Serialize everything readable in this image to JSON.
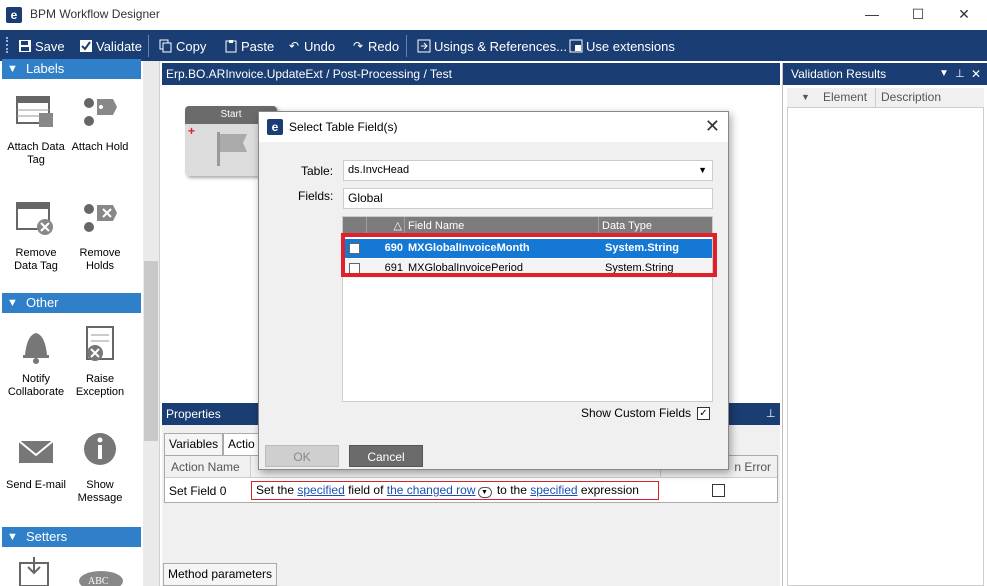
{
  "window": {
    "title": "BPM Workflow Designer",
    "minimize": "—",
    "maximize": "☐",
    "close": "✕"
  },
  "toolbar": {
    "save": "Save",
    "validate": "Validate",
    "copy": "Copy",
    "paste": "Paste",
    "undo": "Undo",
    "redo": "Redo",
    "usings": "Usings & References...",
    "extensions": "Use extensions"
  },
  "palette": {
    "labels_header": "Labels",
    "other_header": "Other",
    "setters_header": "Setters",
    "items": {
      "attach_data_tag": "Attach Data Tag",
      "attach_hold": "Attach Hold",
      "remove_data_tag": "Remove Data Tag",
      "remove_holds": "Remove Holds",
      "notify_collaborate": "Notify Collaborate",
      "raise_exception": "Raise Exception",
      "send_email": "Send E-mail",
      "show_message": "Show Message"
    }
  },
  "canvas": {
    "breadcrumb": "Erp.BO.ARInvoice.UpdateExt / Post-Processing / Test",
    "start_label": "Start"
  },
  "validation": {
    "title": "Validation Results",
    "col_element": "Element",
    "col_description": "Description"
  },
  "properties": {
    "title": "Properties",
    "tab_variables": "Variables",
    "tab_actions": "Actio",
    "col_action_name": "Action Name",
    "col_on_error": "n Error",
    "row_action": "Set Field 0",
    "expr": {
      "p1": "Set the ",
      "link1": "specified",
      "p2": " field of ",
      "link2": "the changed row",
      "p3": " to the ",
      "link3": "specified",
      "p4": " expression"
    },
    "bottom_tab": "Method parameters"
  },
  "dialog": {
    "title": "Select Table Field(s)",
    "table_label": "Table:",
    "table_value": "ds.InvcHead",
    "fields_label": "Fields:",
    "fields_value": "Global",
    "col_field_name": "Field Name",
    "col_data_type": "Data Type",
    "rows": [
      {
        "num": "690",
        "name": "MXGlobalInvoiceMonth",
        "type": "System.String"
      },
      {
        "num": "691",
        "name": "MXGlobalInvoicePeriod",
        "type": "System.String"
      }
    ],
    "show_custom": "Show Custom Fields",
    "show_custom_check": "✓",
    "ok": "OK",
    "cancel": "Cancel"
  }
}
